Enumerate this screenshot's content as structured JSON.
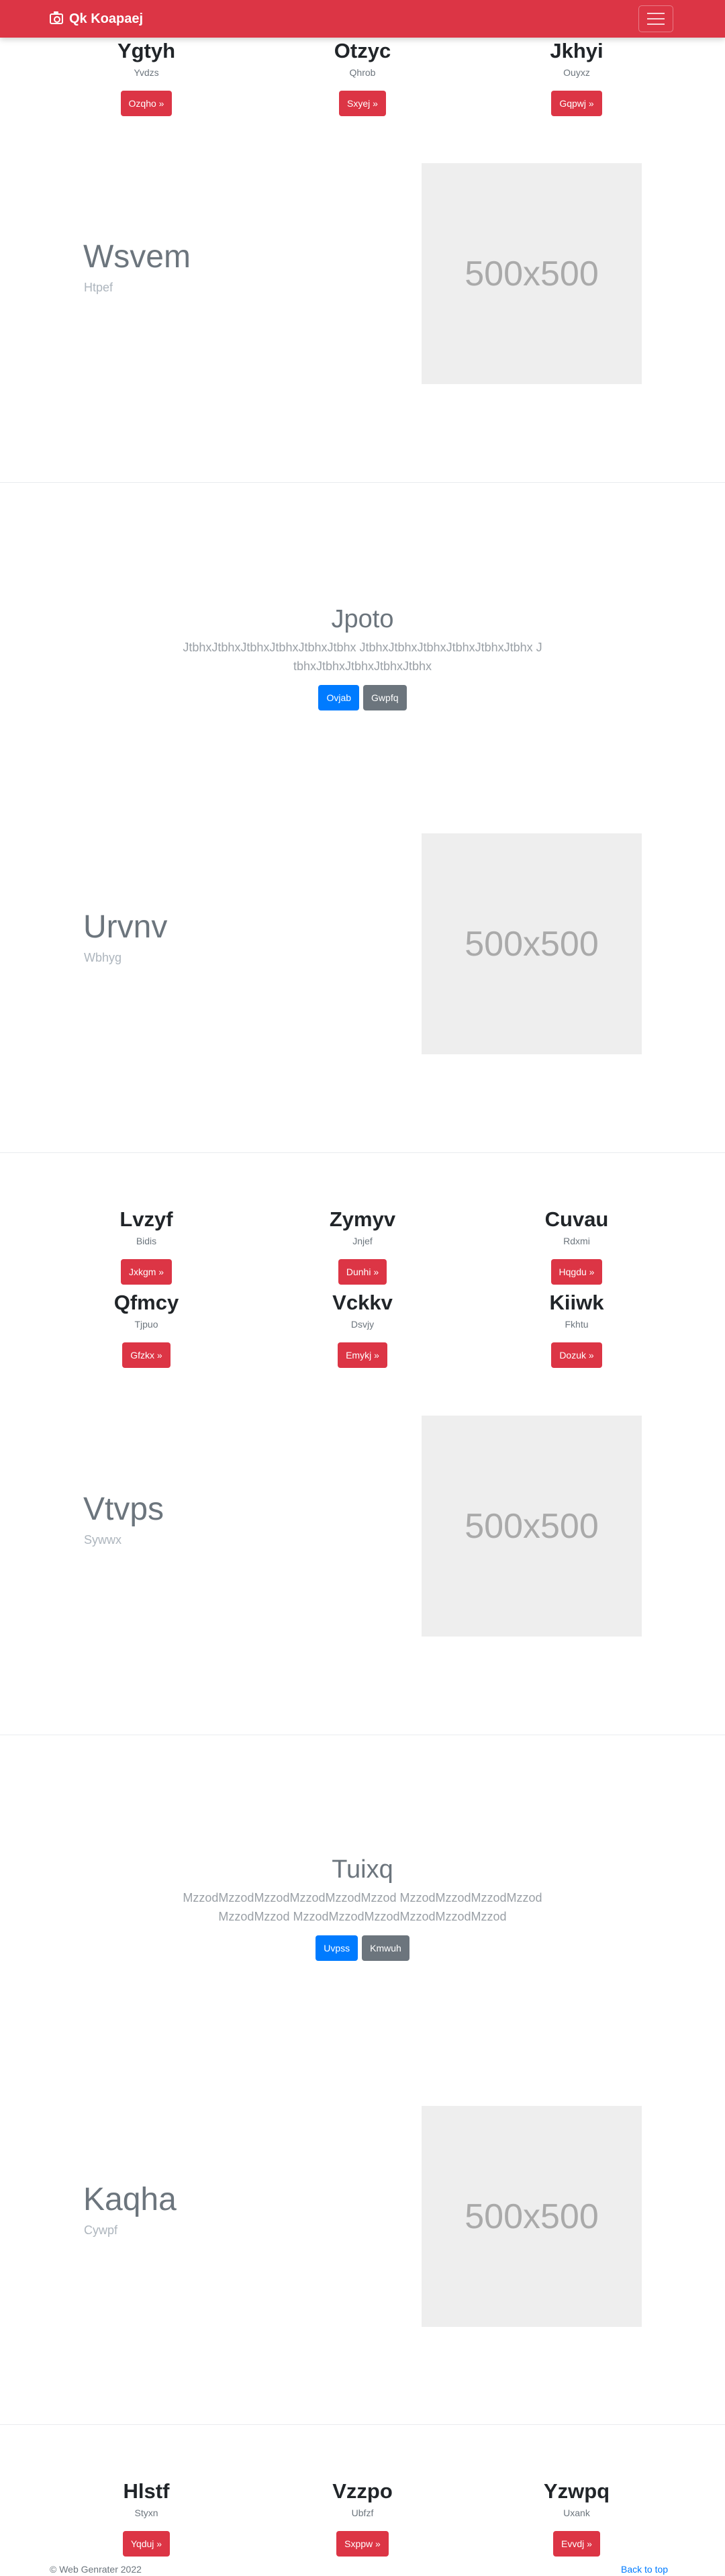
{
  "navbar": {
    "brand": "Qk Koapaej"
  },
  "row1": [
    {
      "title": "Ygtyh",
      "sub": "Yvdzs",
      "button": "Ozqho »"
    },
    {
      "title": "Otzyc",
      "sub": "Qhrob",
      "button": "Sxyej »"
    },
    {
      "title": "Jkhyi",
      "sub": "Ouyxz",
      "button": "Gqpwj »"
    }
  ],
  "feature1": {
    "title": "Wsvem",
    "sub": "Htpef",
    "placeholder": "500x500"
  },
  "jumbo1": {
    "title": "Jpoto",
    "text": "JtbhxJtbhxJtbhxJtbhxJtbhxJtbhx JtbhxJtbhxJtbhxJtbhxJtbhxJtbhx JtbhxJtbhxJtbhxJtbhxJtbhx",
    "primary": "Ovjab",
    "secondary": "Gwpfq"
  },
  "feature2": {
    "title": "Urvnv",
    "sub": "Wbhyg",
    "placeholder": "500x500"
  },
  "row2": [
    {
      "title": "Lvzyf",
      "sub": "Bidis",
      "button": "Jxkgm »"
    },
    {
      "title": "Zymyv",
      "sub": "Jnjef",
      "button": "Dunhi »"
    },
    {
      "title": "Cuvau",
      "sub": "Rdxmi",
      "button": "Hqgdu »"
    }
  ],
  "row3": [
    {
      "title": "Qfmcy",
      "sub": "Tjpuo",
      "button": "Gfzkx »"
    },
    {
      "title": "Vckkv",
      "sub": "Dsvjy",
      "button": "Emykj »"
    },
    {
      "title": "Kiiwk",
      "sub": "Fkhtu",
      "button": "Dozuk »"
    }
  ],
  "feature3": {
    "title": "Vtvps",
    "sub": "Sywwx",
    "placeholder": "500x500"
  },
  "jumbo2": {
    "title": "Tuixq",
    "text": "MzzodMzzodMzzodMzzodMzzodMzzod MzzodMzzodMzzodMzzodMzzodMzzod MzzodMzzodMzzodMzzodMzzodMzzod",
    "primary": "Uvpss",
    "secondary": "Kmwuh"
  },
  "feature4": {
    "title": "Kaqha",
    "sub": "Cywpf",
    "placeholder": "500x500"
  },
  "row4": [
    {
      "title": "Hlstf",
      "sub": "Styxn",
      "button": "Yqduj »"
    },
    {
      "title": "Vzzpo",
      "sub": "Ubfzf",
      "button": "Sxppw »"
    },
    {
      "title": "Yzwpq",
      "sub": "Uxank",
      "button": "Evvdj »"
    }
  ],
  "footer": {
    "copyright": "© Web Genrater 2022",
    "back_to_top": "Back to top"
  }
}
